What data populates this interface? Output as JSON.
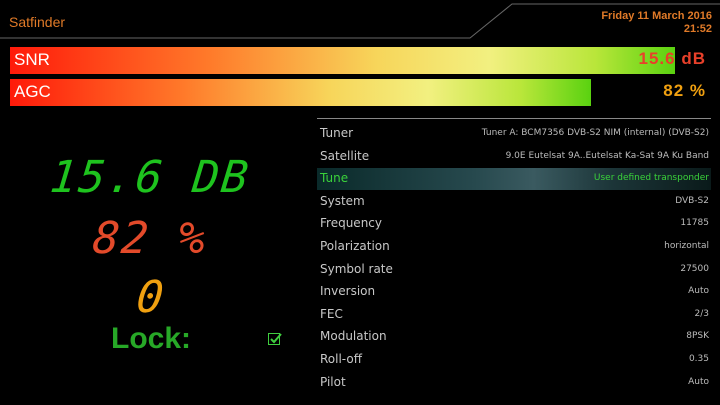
{
  "header": {
    "title": "Satfinder",
    "date": "Friday 11 March 2016",
    "time": "21:52"
  },
  "meters": {
    "snr": {
      "label": "SNR",
      "value_text": "15.6 dB",
      "level": 0.98,
      "value_color": "#e8402a"
    },
    "agc": {
      "label": "AGC",
      "value_text": "82 %",
      "level": 0.83,
      "value_color": "#f0a010"
    }
  },
  "readouts": {
    "snr": "15.6 DB",
    "agc": "82 %",
    "ber": "0",
    "lock_label": "Lock:",
    "locked": true
  },
  "info": [
    {
      "key": "Tuner",
      "value": "Tuner A: BCM7356 DVB-S2 NIM (internal) (DVB-S2)"
    },
    {
      "key": "Satellite",
      "value": "9.0E Eutelsat 9A..Eutelsat Ka-Sat 9A Ku Band"
    },
    {
      "key": "Tune",
      "value": "User defined transponder",
      "selected": true
    },
    {
      "key": "System",
      "value": "DVB-S2"
    },
    {
      "key": "Frequency",
      "value": "11785"
    },
    {
      "key": "Polarization",
      "value": "horizontal"
    },
    {
      "key": "Symbol rate",
      "value": "27500"
    },
    {
      "key": "Inversion",
      "value": "Auto"
    },
    {
      "key": "FEC",
      "value": "2/3"
    },
    {
      "key": "Modulation",
      "value": "8PSK"
    },
    {
      "key": "Roll-off",
      "value": "0.35"
    },
    {
      "key": "Pilot",
      "value": "Auto"
    }
  ],
  "colors": {
    "accent": "#e07a28",
    "snr_green": "#1ec31e",
    "agc_red": "#e34a2a",
    "ber_orange": "#f0a010",
    "lock_green": "#27a827"
  }
}
